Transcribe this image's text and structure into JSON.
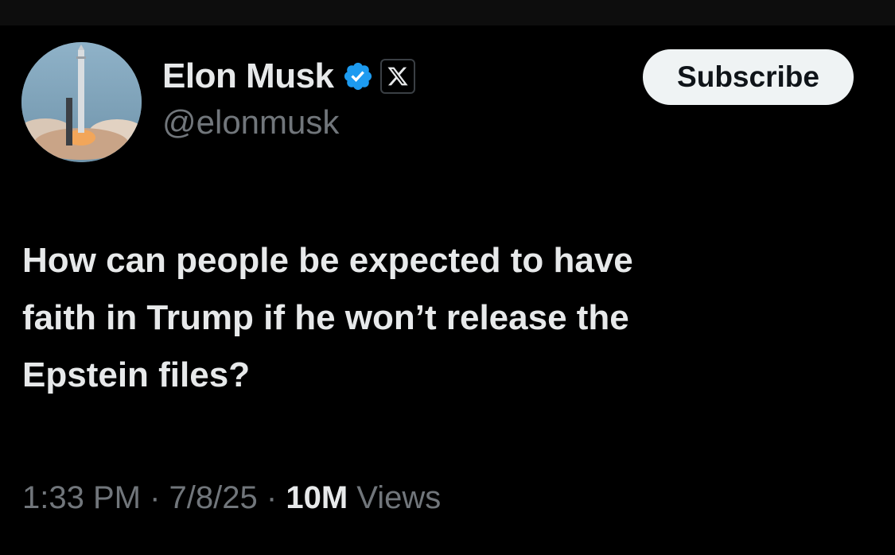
{
  "author": {
    "display_name": "Elon Musk",
    "handle": "@elonmusk",
    "avatar_icon": "rocket-launch-avatar",
    "verified_icon": "verified-badge-icon",
    "affiliate_icon": "x-logo-icon",
    "verified_color": "#1d9bf0"
  },
  "actions": {
    "subscribe_label": "Subscribe"
  },
  "tweet": {
    "line1": "How can people be expected to have",
    "line2": "faith in Trump if he won’t release the",
    "line3": "Epstein files?"
  },
  "meta": {
    "time": "1:33 PM",
    "separator": "·",
    "date": "7/8/25",
    "views_count": "10M",
    "views_label": "Views"
  },
  "colors": {
    "background": "#000000",
    "primary_text": "#e7e9ea",
    "secondary_text": "#71767b",
    "button_bg": "#eff3f4"
  }
}
